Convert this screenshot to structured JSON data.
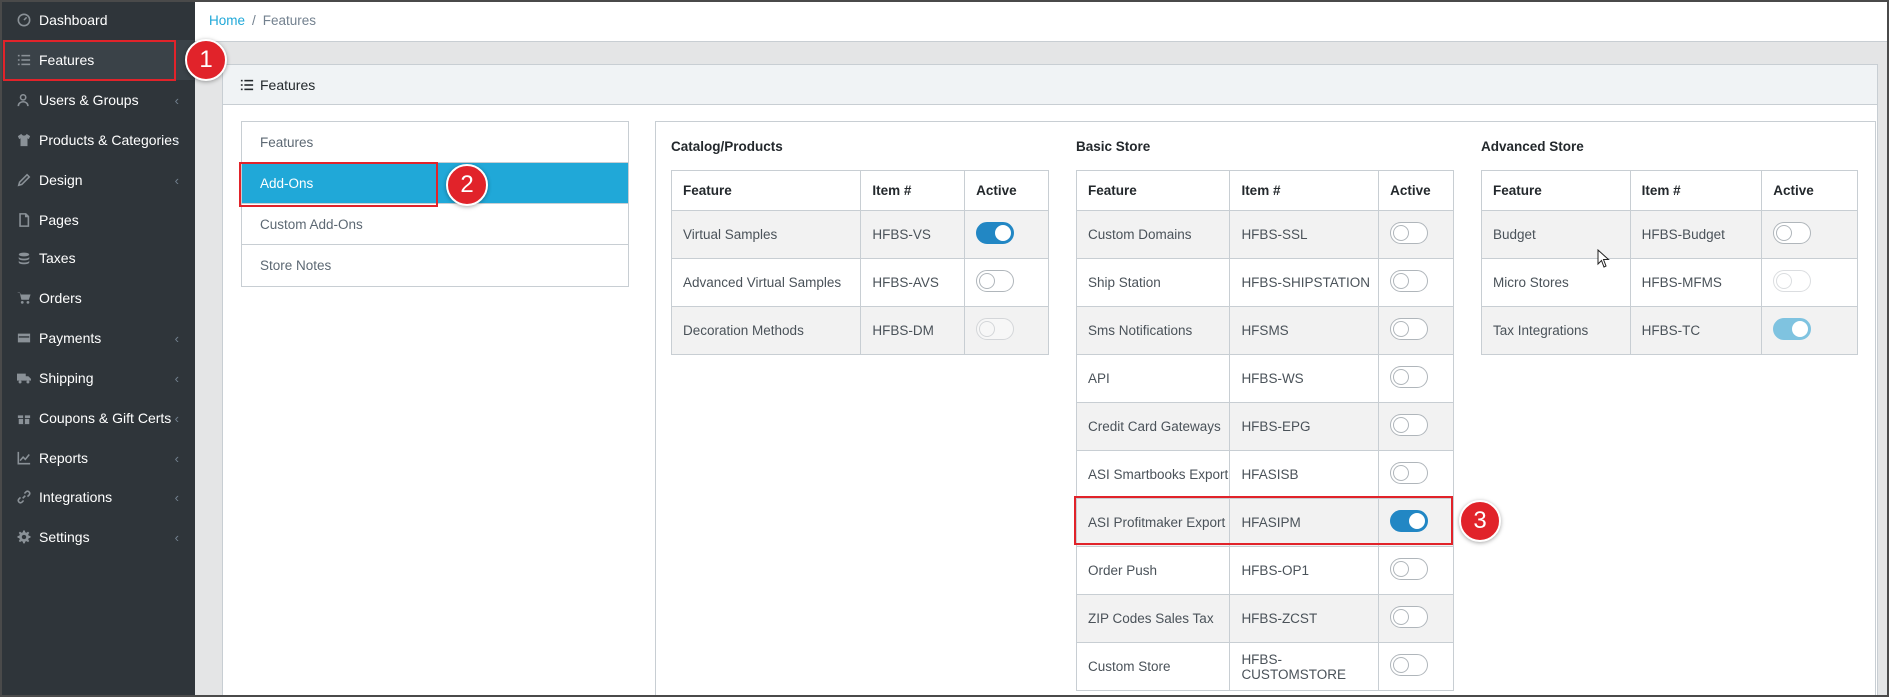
{
  "sidebar": {
    "items": [
      {
        "label": "Dashboard",
        "icon": "dashboard-icon",
        "chevron": false
      },
      {
        "label": "Features",
        "icon": "list-icon",
        "chevron": false
      },
      {
        "label": "Users & Groups",
        "icon": "user-icon",
        "chevron": true
      },
      {
        "label": "Products & Categories",
        "icon": "shirt-icon",
        "chevron": true
      },
      {
        "label": "Design",
        "icon": "pencil-icon",
        "chevron": true
      },
      {
        "label": "Pages",
        "icon": "file-icon",
        "chevron": false
      },
      {
        "label": "Taxes",
        "icon": "coins-icon",
        "chevron": false
      },
      {
        "label": "Orders",
        "icon": "cart-icon",
        "chevron": false
      },
      {
        "label": "Payments",
        "icon": "credit-card-icon",
        "chevron": true
      },
      {
        "label": "Shipping",
        "icon": "truck-icon",
        "chevron": true
      },
      {
        "label": "Coupons & Gift Certs",
        "icon": "gift-icon",
        "chevron": true
      },
      {
        "label": "Reports",
        "icon": "chart-icon",
        "chevron": true
      },
      {
        "label": "Integrations",
        "icon": "link-icon",
        "chevron": true
      },
      {
        "label": "Settings",
        "icon": "gear-icon",
        "chevron": true
      }
    ],
    "chevron_glyph": "‹"
  },
  "breadcrumb": {
    "home": "Home",
    "sep": "/",
    "current": "Features"
  },
  "card": {
    "title": "Features"
  },
  "left_list": {
    "items": [
      "Features",
      "Add-Ons",
      "Custom Add-Ons",
      "Store Notes"
    ],
    "active_index": 1
  },
  "columns": {
    "feature": "Feature",
    "item": "Item #",
    "active": "Active"
  },
  "sections": {
    "catalog": {
      "title": "Catalog/Products",
      "rows": [
        {
          "feature": "Virtual Samples",
          "item": "HFBS-VS",
          "state": "on"
        },
        {
          "feature": "Advanced Virtual Samples",
          "item": "HFBS-AVS",
          "state": "off"
        },
        {
          "feature": "Decoration Methods",
          "item": "HFBS-DM",
          "state": "disabled"
        }
      ]
    },
    "basic": {
      "title": "Basic Store",
      "rows": [
        {
          "feature": "Custom Domains",
          "item": "HFBS-SSL",
          "state": "off"
        },
        {
          "feature": "Ship Station",
          "item": "HFBS-SHIPSTATION",
          "state": "off"
        },
        {
          "feature": "Sms Notifications",
          "item": "HFSMS",
          "state": "off"
        },
        {
          "feature": "API",
          "item": "HFBS-WS",
          "state": "off"
        },
        {
          "feature": "Credit Card Gateways",
          "item": "HFBS-EPG",
          "state": "off"
        },
        {
          "feature": "ASI Smartbooks Export",
          "item": "HFASISB",
          "state": "off"
        },
        {
          "feature": "ASI Profitmaker Export",
          "item": "HFASIPM",
          "state": "on"
        },
        {
          "feature": "Order Push",
          "item": "HFBS-OP1",
          "state": "off"
        },
        {
          "feature": "ZIP Codes Sales Tax",
          "item": "HFBS-ZCST",
          "state": "off"
        },
        {
          "feature": "Custom Store",
          "item": "HFBS-CUSTOMSTORE",
          "state": "off"
        }
      ]
    },
    "advanced": {
      "title": "Advanced Store",
      "rows": [
        {
          "feature": "Budget",
          "item": "HFBS-Budget",
          "state": "off"
        },
        {
          "feature": "Micro Stores",
          "item": "HFBS-MFMS",
          "state": "disabled"
        },
        {
          "feature": "Tax Integrations",
          "item": "HFBS-TC",
          "state": "on-light"
        }
      ]
    }
  },
  "annotations": {
    "badge1": "1",
    "badge2": "2",
    "badge3": "3"
  },
  "colors": {
    "accent": "#20a8d8",
    "toggle_on": "#2287c4",
    "annotation": "#e1232a",
    "sidebar": "#2f353a"
  }
}
